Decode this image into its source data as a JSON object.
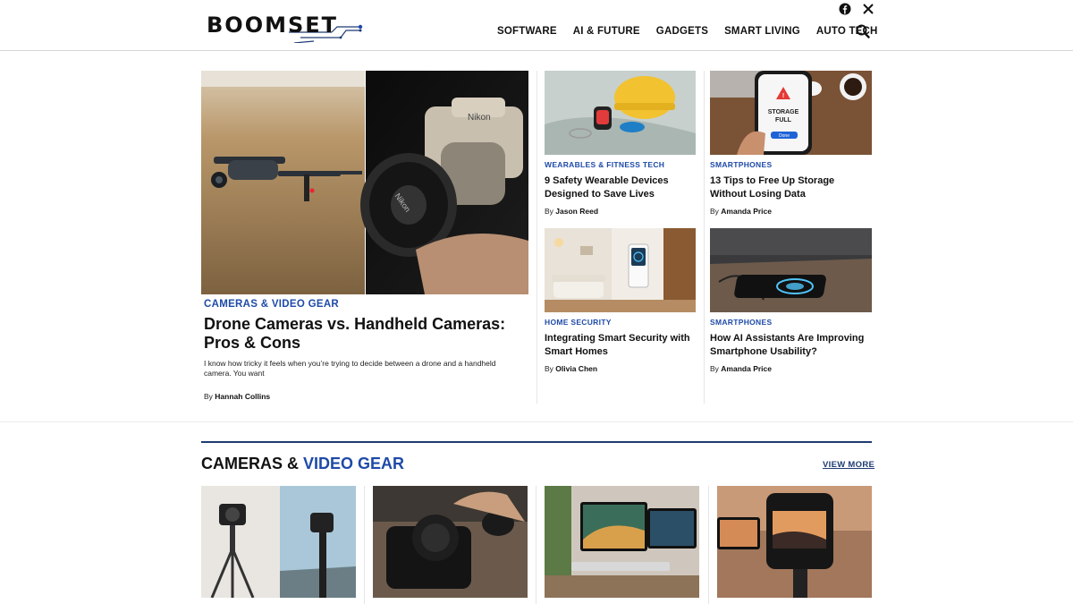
{
  "site": {
    "logo_text": "BOOMSET"
  },
  "nav": {
    "items": [
      "SOFTWARE",
      "AI & FUTURE",
      "GADGETS",
      "SMART LIVING",
      "AUTO TECH"
    ]
  },
  "icons": {
    "facebook": "facebook-icon",
    "x": "x-icon",
    "search": "search-icon"
  },
  "featured": {
    "category": "CAMERAS & VIDEO GEAR",
    "title": "Drone Cameras vs. Handheld Cameras: Pros & Cons",
    "excerpt": "I know how tricky it feels when you’re trying to decide between a drone and a handheld camera. You want",
    "by": "By",
    "author": "Hannah Collins"
  },
  "cards": [
    {
      "category": "WEARABLES & FITNESS TECH",
      "title": "9 Safety Wearable Devices Designed to Save Lives",
      "by": "By",
      "author": "Jason Reed"
    },
    {
      "category": "SMARTPHONES",
      "title": "13 Tips to Free Up Storage Without Losing Data",
      "by": "By",
      "author": "Amanda Price"
    },
    {
      "category": "HOME SECURITY",
      "title": "Integrating Smart Security with Smart Homes",
      "by": "By",
      "author": "Olivia Chen"
    },
    {
      "category": "SMARTPHONES",
      "title": "How AI Assistants Are Improving Smartphone Usability?",
      "by": "By",
      "author": "Amanda Price"
    }
  ],
  "phone_screen": {
    "line1": "STORAGE",
    "line2": "FULL",
    "button": "Done"
  },
  "section": {
    "title_part1": "CAMERAS &",
    "title_part2": "VIDEO GEAR",
    "view_more": "VIEW MORE"
  },
  "colors": {
    "accent": "#1e4aa8",
    "navy": "#1f3b73"
  }
}
